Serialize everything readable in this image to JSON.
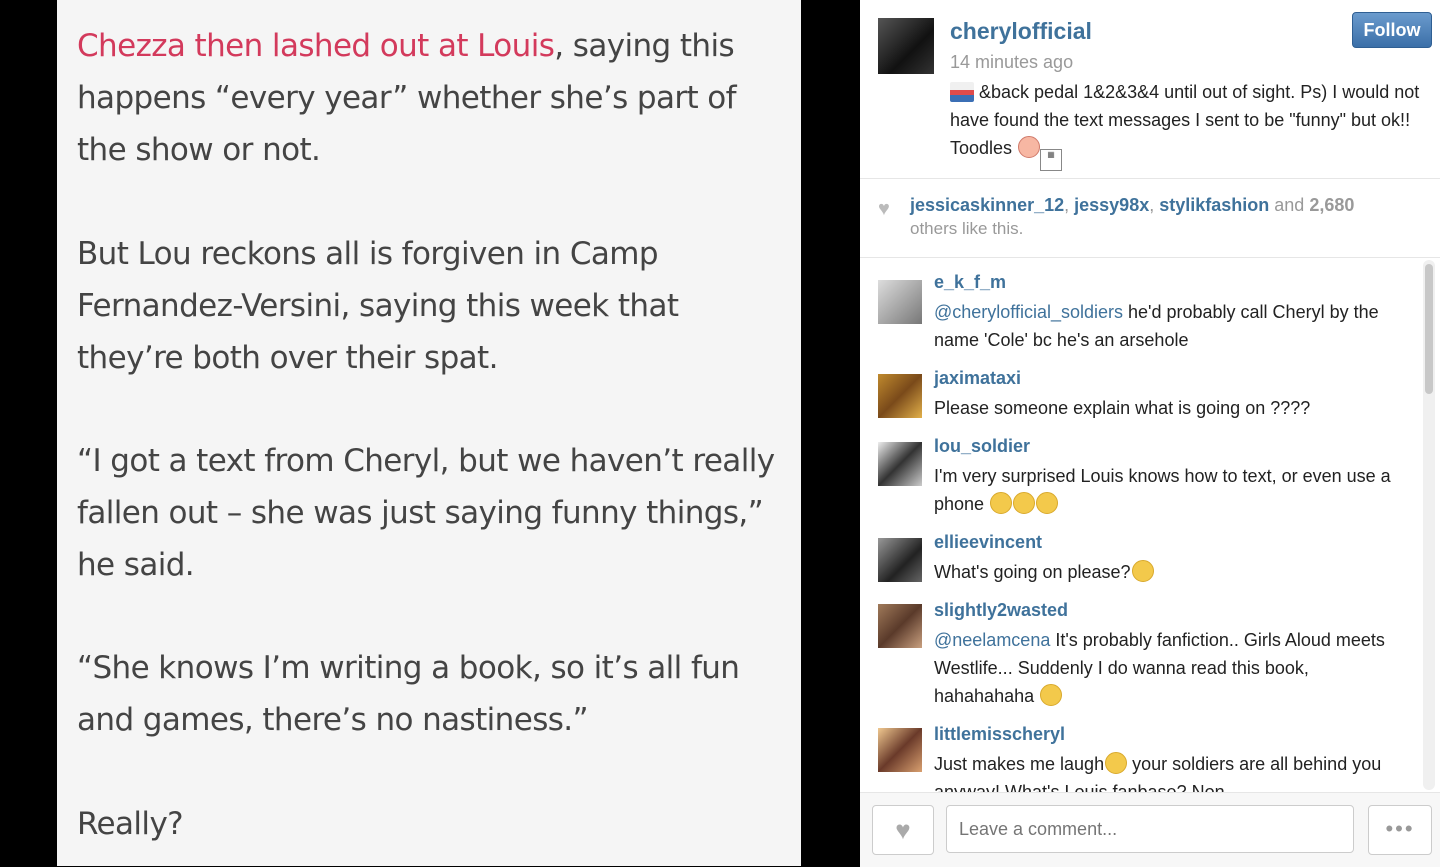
{
  "article": {
    "p1_link": "Chezza then lashed out at Louis",
    "p1_rest": ", saying this happens “every year” whether she’s part of the show or not.",
    "p2": "But Lou reckons all is forgiven in Camp Fernandez-Versini, saying this week that they’re both over their spat.",
    "p3": "“I got a text from Cheryl, but we haven’t really fallen out – she was just saying funny things,” he said.",
    "p4": "“She knows I’m writing a book, so it’s all fun and games, there’s no nastiness.”",
    "p5": "Really?"
  },
  "post": {
    "username": "cherylofficial",
    "follow_label": "Follow",
    "time": "14 minutes ago",
    "caption_1": "&back pedal 1&2&3&4 until out of sight. Ps) I would not have found the text messages I sent to be \"funny\" but ok!! Toodles",
    "likes": {
      "user1": "jessicaskinner_12",
      "user2": "jessy98x",
      "user3": "stylikfashion",
      "and": "and",
      "count": "2,680",
      "rest": "others like this."
    }
  },
  "comments": [
    {
      "user": "e_k_f_m",
      "mention": "@cherylofficial_soldiers",
      "text": " he'd probably call Cheryl by the name 'Cole' bc he's an arsehole"
    },
    {
      "user": "jaximataxi",
      "mention": "",
      "text": "Please someone explain what is going on ????"
    },
    {
      "user": "lou_soldier",
      "mention": "",
      "text": "I'm very surprised Louis knows how to text, or even use a phone"
    },
    {
      "user": "ellieevincent",
      "mention": "",
      "text": "What's going on please?"
    },
    {
      "user": "slightly2wasted",
      "mention": "@neelamcena",
      "text": " It's probably fanfiction.. Girls Aloud meets Westlife... Suddenly I do wanna read this book, hahahahaha"
    },
    {
      "user": "littlemisscheryl",
      "mention": "",
      "text_a": "Just makes me laugh",
      "text_b": " your soldiers are all behind you anyway! What's Louis fanbase? Non"
    }
  ],
  "footer": {
    "comment_placeholder": "Leave a comment...",
    "more_label": "•••"
  },
  "icons": {
    "heart": "heart-icon",
    "more": "more-icon"
  }
}
